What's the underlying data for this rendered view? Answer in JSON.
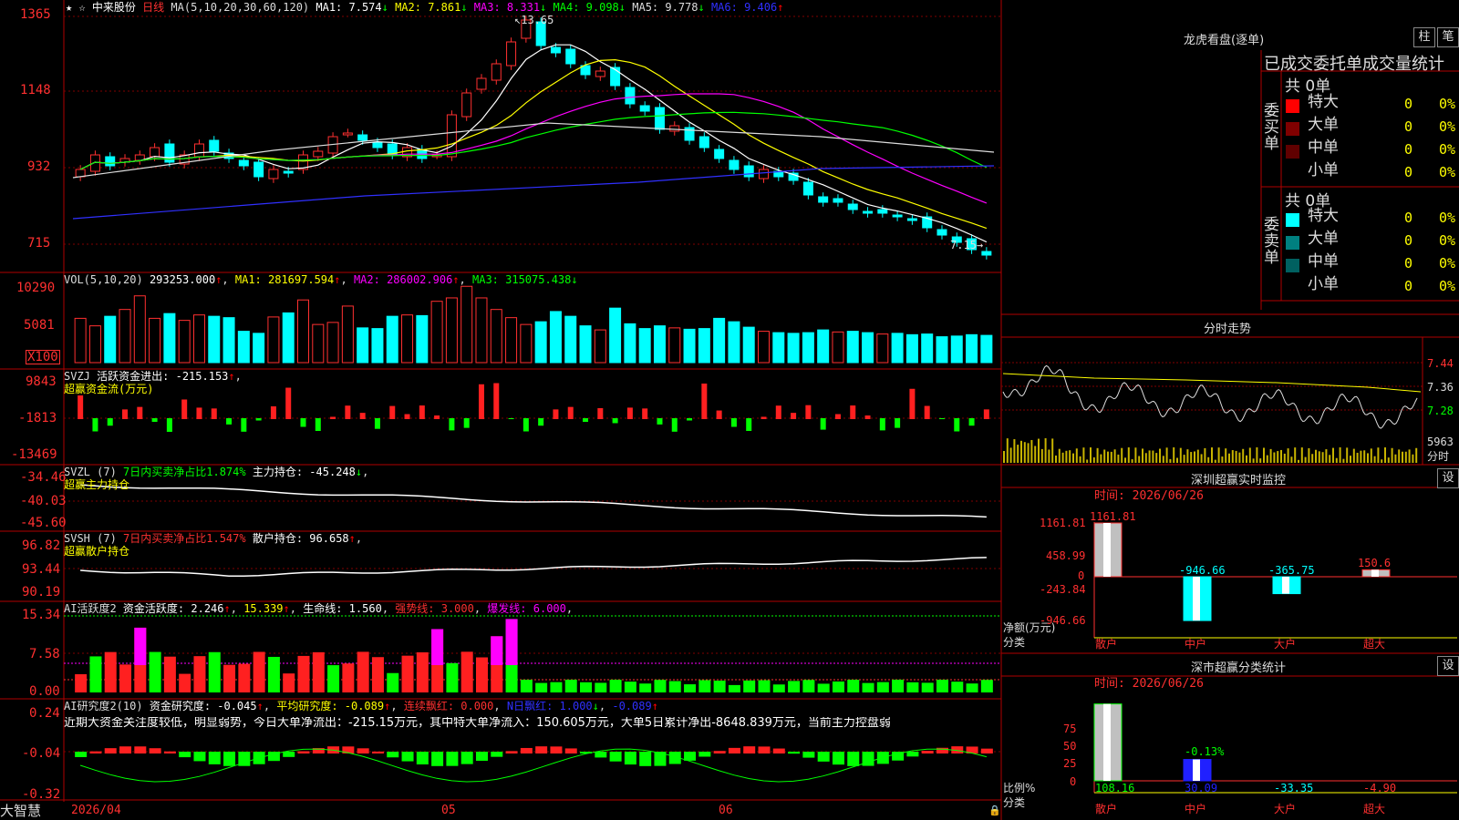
{
  "header": {
    "stock_name": "中来股份",
    "period": "日线",
    "ma_label": "MA(5,10,20,30,60,120)",
    "ma_values": [
      {
        "name": "MA1",
        "value": "7.574",
        "dir": "↓",
        "color": "#ffffff"
      },
      {
        "name": "MA2",
        "value": "7.861",
        "dir": "↓",
        "color": "#ffff00"
      },
      {
        "name": "MA3",
        "value": "8.331",
        "dir": "↓",
        "color": "#ff00ff"
      },
      {
        "name": "MA4",
        "value": "9.098",
        "dir": "↓",
        "color": "#00ff00"
      },
      {
        "name": "MA5",
        "value": "9.778",
        "dir": "↓",
        "color": "#dddddd"
      },
      {
        "name": "MA6",
        "value": "9.406",
        "dir": "↑",
        "color": "#3030ff"
      }
    ],
    "high_mark": "13.65",
    "low_mark": "7.15",
    "ylabels": [
      "1365",
      "1148",
      "932",
      "715"
    ]
  },
  "vol": {
    "title": "VOL(5,10,20)",
    "value": "293253.000",
    "ma1": "281697.594",
    "ma2": "286002.906",
    "ma3": "315075.438",
    "ylabels": [
      "10290",
      "5081"
    ],
    "unit": "X100"
  },
  "svzj": {
    "title": "SVZJ",
    "label": "活跃资金进出: -215.153",
    "subtitle": "超赢资金流(万元)",
    "ylabels": [
      "9843",
      "-1813",
      "-13469"
    ]
  },
  "svzl": {
    "title": "SVZL (7)",
    "label": "7日内买卖净占比1.874%",
    "label2": "主力持仓: -45.248",
    "subtitle": "超赢主力持仓",
    "ylabels": [
      "-34.46",
      "-40.03",
      "-45.60"
    ]
  },
  "svsh": {
    "title": "SVSH (7)",
    "label": "7日内买卖净占比1.547%",
    "label2": "散户持仓: 96.658",
    "subtitle": "超赢散户持仓",
    "ylabels": [
      "96.82",
      "93.44",
      "90.19"
    ]
  },
  "ai1": {
    "title": "AI活跃度2",
    "label": "资金活跃度: 2.246",
    "v2": "15.339",
    "life": "生命线: 1.560",
    "strong": "强势线: 3.000",
    "burst": "爆发线: 6.000",
    "ylabels": [
      "15.34",
      "7.58",
      "0.00"
    ]
  },
  "ai2": {
    "title": "AI研究度2(10)",
    "label": "资金研究度: -0.045",
    "avg": "平均研究度: -0.089",
    "red": "连续飘红: 0.000",
    "nred": "N日飘红: 1.000",
    "last": "-0.089",
    "comment": "近期大资金关注度较低，明显弱势，今日大单净流出：-215.15万元，其中特大单净流入：150.605万元，大单5日累计净出-8648.839万元，当前主力控盘弱",
    "ylabels": [
      "0.24",
      "-0.04",
      "-0.32"
    ]
  },
  "xaxis": {
    "start": "2026/04",
    "m1": "05",
    "m2": "06"
  },
  "brand": "大智慧",
  "right": {
    "lhb_title": "龙虎看盘(逐单)",
    "btn_zhu": "柱",
    "btn_bi": "笔",
    "tabs_title": "已成交委托单成交量统计",
    "buy_label": "委买单",
    "sell_label": "委卖单",
    "buy_total": "共 0单",
    "sell_total": "共 0单",
    "buy_rows": [
      {
        "name": "特大",
        "n": "0",
        "p": "0%",
        "color": "#ff0000"
      },
      {
        "name": "大单",
        "n": "0",
        "p": "0%",
        "color": "#800000"
      },
      {
        "name": "中单",
        "n": "0",
        "p": "0%",
        "color": "#600000"
      },
      {
        "name": "小单",
        "n": "0",
        "p": "0%",
        "color": ""
      }
    ],
    "sell_rows": [
      {
        "name": "特大",
        "n": "0",
        "p": "0%",
        "color": "#00ffff"
      },
      {
        "name": "大单",
        "n": "0",
        "p": "0%",
        "color": "#008080"
      },
      {
        "name": "中单",
        "n": "0",
        "p": "0%",
        "color": "#006060"
      },
      {
        "name": "小单",
        "n": "0",
        "p": "0%",
        "color": ""
      }
    ],
    "intraday_title": "分时走势",
    "intraday_ylabels": [
      "7.44",
      "7.36",
      "7.28"
    ],
    "intraday_vol": "5963",
    "intraday_unit": "分时",
    "monitor_title": "深圳超赢实时监控",
    "monitor_btn": "设",
    "monitor_time": "时间: 2026/06/26",
    "monitor_ylabels": [
      "1161.81",
      "458.99",
      "0",
      "-243.84",
      "-946.66"
    ],
    "monitor_unit": "净额(万元)",
    "monitor_cat_label": "分类",
    "monitor_bars": [
      {
        "cat": "散户",
        "value": 1161.81,
        "label": "1161.81"
      },
      {
        "cat": "中户",
        "value": -946.66,
        "label": "-946.66"
      },
      {
        "cat": "大户",
        "value": -365.75,
        "label": "-365.75"
      },
      {
        "cat": "超大",
        "value": 150.6,
        "label": "150.6"
      }
    ],
    "class_title": "深市超赢分类统计",
    "class_btn": "设",
    "class_time": "时间: 2026/06/26",
    "class_ylabels": [
      "75",
      "50",
      "25",
      "0"
    ],
    "class_unit": "比例%",
    "class_cat_label": "分类",
    "class_bars": [
      {
        "cat": "散户",
        "value": 108.16,
        "label": "108.16"
      },
      {
        "cat": "中户",
        "value": 30.09,
        "label": "30.09"
      },
      {
        "cat": "大户",
        "value": -33.35,
        "label": "-33.35"
      },
      {
        "cat": "超大",
        "value": -4.9,
        "label": "-4.90"
      }
    ],
    "class_note": "-0.13%"
  },
  "chart_data": {
    "type": "bar",
    "title": "中来股份 日线",
    "note": "Candlestick (daily) chart with volume and indicator sub-panels",
    "candles_close": [
      9.5,
      9.9,
      9.6,
      9.8,
      9.9,
      10.1,
      9.7,
      9.9,
      10.2,
      10.0,
      9.8,
      9.6,
      9.3,
      9.5,
      9.4,
      9.9,
      10.0,
      10.4,
      10.5,
      10.3,
      10.1,
      9.9,
      10.1,
      9.8,
      9.9,
      11.0,
      11.6,
      12.0,
      12.4,
      13.0,
      13.6,
      12.9,
      12.7,
      12.4,
      12.1,
      12.2,
      11.8,
      11.3,
      11.1,
      10.6,
      10.7,
      10.3,
      10.1,
      9.8,
      9.5,
      9.3,
      9.5,
      9.3,
      9.2,
      8.8,
      8.6,
      8.6,
      8.4,
      8.3,
      8.3,
      8.2,
      8.1,
      7.9,
      7.7,
      7.5,
      7.3,
      7.15
    ],
    "volume": [
      6500,
      5400,
      6800,
      7800,
      9800,
      6500,
      7200,
      6200,
      7000,
      6800,
      6600,
      4600,
      4300,
      6700,
      7300,
      9200,
      5600,
      5900,
      8300,
      5100,
      5000,
      6800,
      7000,
      6900,
      9000,
      9500,
      11200,
      9500,
      7800,
      6600,
      5600,
      6000,
      7500,
      6800,
      5400,
      4800,
      8000,
      5700,
      5000,
      5400,
      5100,
      4900,
      5000,
      6500,
      6000,
      5200,
      4600,
      4400,
      4300,
      4400,
      4800,
      4500,
      4600,
      4400,
      4200,
      4300,
      4100,
      4200,
      3800,
      3900,
      4100,
      4000
    ]
  }
}
